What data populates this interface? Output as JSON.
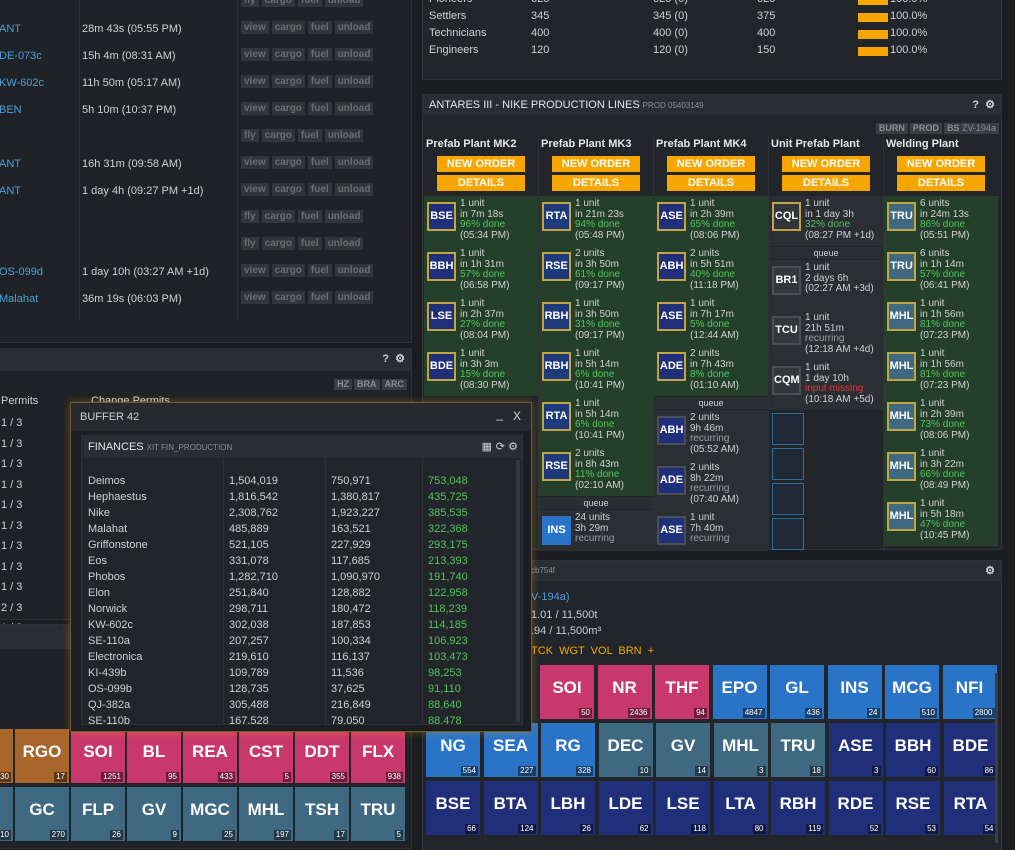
{
  "ships": {
    "rows": [
      {
        "dest": "ANT",
        "eta": "28m 43s (05:55 PM)",
        "actions": [
          "view",
          "cargo",
          "fuel",
          "unload"
        ]
      },
      {
        "dest": "DE-073c",
        "eta": "15h 4m (08:31 AM)",
        "actions": [
          "view",
          "cargo",
          "fuel",
          "unload"
        ]
      },
      {
        "dest": "KW-602c",
        "eta": "11h 50m (05:17 AM)",
        "actions": [
          "view",
          "cargo",
          "fuel",
          "unload"
        ]
      },
      {
        "dest": "BEN",
        "eta": "5h 10m (10:37 PM)",
        "actions": [
          "view",
          "cargo",
          "fuel",
          "unload"
        ]
      },
      {
        "dest": "",
        "eta": "",
        "actions": [
          "fly",
          "cargo",
          "fuel",
          "unload"
        ]
      },
      {
        "dest": "ANT",
        "eta": "16h 31m (09:58 AM)",
        "actions": [
          "view",
          "cargo",
          "fuel",
          "unload"
        ]
      },
      {
        "dest": "ANT",
        "eta": "1 day 4h (09:27 PM +1d)",
        "actions": [
          "view",
          "cargo",
          "fuel",
          "unload"
        ]
      },
      {
        "dest": "",
        "eta": "",
        "actions": [
          "fly",
          "cargo",
          "fuel",
          "unload"
        ]
      },
      {
        "dest": "",
        "eta": "",
        "actions": [
          "fly",
          "cargo",
          "fuel",
          "unload"
        ]
      },
      {
        "dest": "OS-099d",
        "eta": "1 day 10h (03:27 AM +1d)",
        "actions": [
          "view",
          "cargo",
          "fuel",
          "unload"
        ]
      },
      {
        "dest": "Malahat",
        "eta": "36m 19s (06:03 PM)",
        "actions": [
          "view",
          "cargo",
          "fuel",
          "unload"
        ]
      }
    ],
    "top_actions": [
      "fly",
      "cargo",
      "fuel",
      "unload"
    ]
  },
  "workforce": {
    "rows": [
      {
        "name": "Pioneers",
        "a": "625",
        "b": "625 (0)",
        "c": "625",
        "pct": "100.0%"
      },
      {
        "name": "Settlers",
        "a": "345",
        "b": "345 (0)",
        "c": "375",
        "pct": "100.0%"
      },
      {
        "name": "Technicians",
        "a": "400",
        "b": "400 (0)",
        "c": "400",
        "pct": "100.0%"
      },
      {
        "name": "Engineers",
        "a": "120",
        "b": "120 (0)",
        "c": "150",
        "pct": "100.0%"
      }
    ]
  },
  "production": {
    "title": "ANTARES III - NIKE PRODUCTION LINES",
    "sub": "PROD 05403149",
    "tags": [
      "BURN",
      "PROD",
      "BS"
    ],
    "tag_extra": "ZV-194a",
    "new_order": "NEW ORDER",
    "details": "DETAILS",
    "queue": "queue",
    "lines": [
      {
        "name": "Prefab Plant MK2",
        "slots": [
          {
            "t": "BSE",
            "a": "1 unit",
            "b": "in 7m 18s",
            "c": "96% done",
            "d": "(05:34 PM)",
            "act": true
          },
          {
            "t": "BBH",
            "a": "1 unit",
            "b": "in 1h 31m",
            "c": "57% done",
            "d": "(06:58 PM)",
            "act": true
          },
          {
            "t": "LSE",
            "a": "1 unit",
            "b": "in 2h 37m",
            "c": "27% done",
            "d": "(08:04 PM)",
            "act": true
          },
          {
            "t": "BDE",
            "a": "1 unit",
            "b": "in 3h 3m",
            "c": "15% done",
            "d": "(08:30 PM)",
            "act": true
          }
        ]
      },
      {
        "name": "Prefab Plant MK3",
        "slots": [
          {
            "t": "RTA",
            "a": "1 unit",
            "b": "in 21m 23s",
            "c": "94% done",
            "d": "(05:48 PM)",
            "act": true
          },
          {
            "t": "RSE",
            "a": "2 units",
            "b": "in 3h 50m",
            "c": "61% done",
            "d": "(09:17 PM)",
            "act": true
          },
          {
            "t": "RBH",
            "a": "1 unit",
            "b": "in 3h 50m",
            "c": "31% done",
            "d": "(09:17 PM)",
            "act": true
          },
          {
            "t": "RBH",
            "a": "1 unit",
            "b": "in 5h 14m",
            "c": "6% done",
            "d": "(10:41 PM)",
            "act": true
          },
          {
            "t": "RTA",
            "a": "1 unit",
            "b": "in 5h 14m",
            "c": "6% done",
            "d": "(10:41 PM)",
            "act": true
          },
          {
            "t": "RSE",
            "a": "2 units",
            "b": "in 8h 43m",
            "c": "11% done",
            "d": "(02:10 AM)",
            "act": true
          },
          {
            "t": "INS",
            "a": "24 units",
            "b": "3h 29m",
            "c": "",
            "d": "recurring",
            "act": false,
            "q": true
          }
        ]
      },
      {
        "name": "Prefab Plant MK4",
        "slots": [
          {
            "t": "ASE",
            "a": "1 unit",
            "b": "in 2h 39m",
            "c": "65% done",
            "d": "(08:06 PM)",
            "act": true
          },
          {
            "t": "ABH",
            "a": "2 units",
            "b": "in 5h 51m",
            "c": "40% done",
            "d": "(11:18 PM)",
            "act": true
          },
          {
            "t": "ASE",
            "a": "1 unit",
            "b": "in 7h 17m",
            "c": "5% done",
            "d": "(12:44 AM)",
            "act": true
          },
          {
            "t": "ADE",
            "a": "2 units",
            "b": "in 7h 43m",
            "c": "8% done",
            "d": "(01:10 AM)",
            "act": true
          },
          {
            "t": "ABH",
            "a": "2 units",
            "b": "9h 46m",
            "c": "",
            "d": "recurring",
            "d2": "(05:52 AM)",
            "act": false,
            "q": true
          },
          {
            "t": "ADE",
            "a": "2 units",
            "b": "8h 22m",
            "c": "",
            "d": "recurring",
            "d2": "(07:40 AM)",
            "act": false,
            "q": true
          },
          {
            "t": "ASE",
            "a": "1 unit",
            "b": "7h 40m",
            "c": "",
            "d": "recurring",
            "act": false,
            "q": true
          }
        ]
      },
      {
        "name": "Unit Prefab Plant",
        "slots": [
          {
            "t": "CQL",
            "a": "1 unit",
            "b": "in 1 day 3h",
            "c": "32% done",
            "d": "(08:27 PM +1d)",
            "act": false
          },
          {
            "t": "BR1",
            "a": "1 unit",
            "b": "2 days 6h",
            "c": "",
            "d": "(02:27 AM +3d)",
            "act": false,
            "q": true
          },
          {
            "t": "TCU",
            "a": "1 unit",
            "b": "21h 51m",
            "c": "",
            "d": "recurring",
            "d2": "(12:18 AM +4d)",
            "act": false,
            "q": true
          },
          {
            "t": "CQM",
            "a": "1 unit",
            "b": "1 day 10h",
            "c": "",
            "e": "input missing",
            "d": "(10:18 AM +5d)",
            "act": false,
            "q": true
          }
        ]
      },
      {
        "name": "Welding Plant",
        "slots": [
          {
            "t": "TRU",
            "a": "6 units",
            "b": "in 24m 13s",
            "c": "86% done",
            "d": "(05:51 PM)",
            "act": true
          },
          {
            "t": "TRU",
            "a": "6 units",
            "b": "in 1h 14m",
            "c": "57% done",
            "d": "(06:41 PM)",
            "act": true
          },
          {
            "t": "MHL",
            "a": "1 unit",
            "b": "in 1h 56m",
            "c": "81% done",
            "d": "(07:23 PM)",
            "act": true
          },
          {
            "t": "MHL",
            "a": "1 unit",
            "b": "in 1h 56m",
            "c": "81% done",
            "d": "(07:23 PM)",
            "act": true
          },
          {
            "t": "MHL",
            "a": "1 unit",
            "b": "in 2h 39m",
            "c": "73% done",
            "d": "(08:06 PM)",
            "act": true
          },
          {
            "t": "MHL",
            "a": "1 unit",
            "b": "in 3h 22m",
            "c": "66% done",
            "d": "(08:49 PM)",
            "act": true
          },
          {
            "t": "MHL",
            "a": "1 unit",
            "b": "in 5h 18m",
            "c": "47% done",
            "d": "(10:45 PM)",
            "act": true
          }
        ]
      }
    ]
  },
  "permits": {
    "col1": "Permits",
    "col2": "Change Permits",
    "rows": [
      "1 / 3",
      "1 / 3",
      "1 / 3",
      "1 / 3",
      "1 / 3",
      "1 / 3",
      "1 / 3",
      "1 / 3",
      "1 / 3",
      "2 / 3",
      "1 / 3"
    ],
    "tags": [
      "HZ",
      "BRA",
      "ARC"
    ]
  },
  "storage": {
    "id": "cb754f",
    "line1": "V-194a)",
    "line2": "1.01 / 11,500t",
    "line3": ".94 / 11,500m³",
    "sorts": "TCK  WGT  VOL  BRN  +"
  },
  "buffer": {
    "title": "BUFFER 42",
    "min": "_",
    "close": "X",
    "fin_title": "FINANCES",
    "fin_sub": "XIT FIN_PRODUCTION",
    "rows": [
      [
        "Deimos",
        "1,504,019",
        "750,971",
        "753,048"
      ],
      [
        "Hephaestus",
        "1,816,542",
        "1,380,817",
        "435,725"
      ],
      [
        "Nike",
        "2,308,762",
        "1,923,227",
        "385,535"
      ],
      [
        "Malahat",
        "485,889",
        "163,521",
        "322,368"
      ],
      [
        "Griffonstone",
        "521,105",
        "227,929",
        "293,175"
      ],
      [
        "Eos",
        "331,078",
        "117,685",
        "213,393"
      ],
      [
        "Phobos",
        "1,282,710",
        "1,090,970",
        "191,740"
      ],
      [
        "Elon",
        "251,840",
        "128,882",
        "122,958"
      ],
      [
        "Norwick",
        "298,711",
        "180,472",
        "118,239"
      ],
      [
        "KW-602c",
        "302,038",
        "187,853",
        "114,185"
      ],
      [
        "SE-110a",
        "207,257",
        "100,334",
        "106,923"
      ],
      [
        "Electronica",
        "219,610",
        "116,137",
        "103,473"
      ],
      [
        "KI-439b",
        "109,789",
        "11,536",
        "98,253"
      ],
      [
        "OS-099b",
        "128,735",
        "37,625",
        "91,110"
      ],
      [
        "QJ-382a",
        "305,488",
        "216,849",
        "88,640"
      ],
      [
        "SE-110b",
        "167,528",
        "79,050",
        "88,478"
      ]
    ]
  },
  "inventory": {
    "left_row1": [
      {
        "t": "",
        "n": "30",
        "c": "#a8662a"
      },
      {
        "t": "RGO",
        "n": "17",
        "c": "#a8662a"
      },
      {
        "t": "SOI",
        "n": "1251",
        "c": "#c8386a"
      },
      {
        "t": "BL",
        "n": "95",
        "c": "#c8386a"
      },
      {
        "t": "REA",
        "n": "433",
        "c": "#c8386a"
      },
      {
        "t": "CST",
        "n": "5",
        "c": "#c8386a"
      },
      {
        "t": "DDT",
        "n": "355",
        "c": "#c8386a"
      },
      {
        "t": "FLX",
        "n": "938",
        "c": "#c8386a"
      }
    ],
    "left_row2": [
      {
        "t": "",
        "n": "10",
        "c": "#3f6882"
      },
      {
        "t": "GC",
        "n": "270",
        "c": "#3f6882"
      },
      {
        "t": "FLP",
        "n": "26",
        "c": "#3f6882"
      },
      {
        "t": "GV",
        "n": "9",
        "c": "#3f6882"
      },
      {
        "t": "MGC",
        "n": "25",
        "c": "#3f6882"
      },
      {
        "t": "MHL",
        "n": "197",
        "c": "#3f6882"
      },
      {
        "t": "TSH",
        "n": "17",
        "c": "#3f6882"
      },
      {
        "t": "TRU",
        "n": "5",
        "c": "#3f6882"
      }
    ],
    "right_row1": [
      {
        "t": "SOI",
        "n": "50",
        "c": "#c8386a"
      },
      {
        "t": "NR",
        "n": "2436",
        "c": "#c8386a"
      },
      {
        "t": "THF",
        "n": "94",
        "c": "#c8386a"
      },
      {
        "t": "EPO",
        "n": "4847",
        "c": "#2a74c8"
      },
      {
        "t": "GL",
        "n": "436",
        "c": "#2a74c8"
      },
      {
        "t": "INS",
        "n": "24",
        "c": "#2a74c8"
      },
      {
        "t": "MCG",
        "n": "510",
        "c": "#2a74c8"
      },
      {
        "t": "NFI",
        "n": "2800",
        "c": "#2a74c8"
      }
    ],
    "right_row2": [
      {
        "t": "NG",
        "n": "554",
        "c": "#2a74c8"
      },
      {
        "t": "SEA",
        "n": "227",
        "c": "#2a74c8"
      },
      {
        "t": "RG",
        "n": "328",
        "c": "#2a74c8"
      },
      {
        "t": "DEC",
        "n": "10",
        "c": "#3f6882"
      },
      {
        "t": "GV",
        "n": "14",
        "c": "#3f6882"
      },
      {
        "t": "MHL",
        "n": "3",
        "c": "#3f6882"
      },
      {
        "t": "TRU",
        "n": "18",
        "c": "#3f6882"
      },
      {
        "t": "ASE",
        "n": "3",
        "c": "#1f2f7a"
      },
      {
        "t": "BBH",
        "n": "60",
        "c": "#1f2f7a"
      },
      {
        "t": "BDE",
        "n": "86",
        "c": "#1f2f7a"
      }
    ],
    "right_row3": [
      {
        "t": "BSE",
        "n": "66",
        "c": "#1f2f7a"
      },
      {
        "t": "BTA",
        "n": "124",
        "c": "#1f2f7a"
      },
      {
        "t": "LBH",
        "n": "26",
        "c": "#1f2f7a"
      },
      {
        "t": "LDE",
        "n": "62",
        "c": "#1f2f7a"
      },
      {
        "t": "LSE",
        "n": "118",
        "c": "#1f2f7a"
      },
      {
        "t": "LTA",
        "n": "80",
        "c": "#1f2f7a"
      },
      {
        "t": "RBH",
        "n": "119",
        "c": "#1f2f7a"
      },
      {
        "t": "RDE",
        "n": "52",
        "c": "#1f2f7a"
      },
      {
        "t": "RSE",
        "n": "53",
        "c": "#1f2f7a"
      },
      {
        "t": "RTA",
        "n": "54",
        "c": "#1f2f7a"
      }
    ]
  }
}
